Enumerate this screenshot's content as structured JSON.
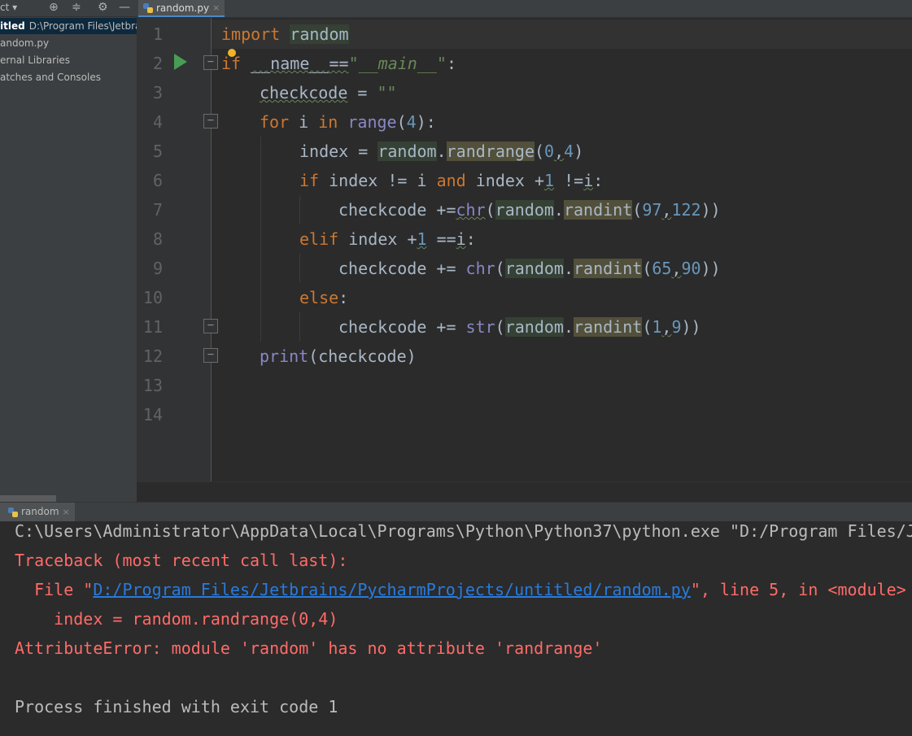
{
  "project_panel": {
    "title": "ct",
    "tree": [
      {
        "bold": "itled",
        "path": "D:\\Program Files\\Jetbra"
      },
      {
        "label": "andom.py"
      },
      {
        "label": "ernal Libraries"
      },
      {
        "label": "atches and Consoles"
      }
    ]
  },
  "editor_tab": {
    "label": "random.py",
    "close": "×"
  },
  "line_numbers": [
    "1",
    "2",
    "3",
    "4",
    "5",
    "6",
    "7",
    "8",
    "9",
    "10",
    "11",
    "12",
    "13",
    "14"
  ],
  "code": {
    "l1": [
      "import",
      "random"
    ],
    "l2": [
      "if",
      "__name__",
      "==",
      "\"__main__\"",
      ":"
    ],
    "l3": [
      "checkcode",
      " = ",
      "\"\""
    ],
    "l4": [
      "for",
      " i ",
      "in",
      " ",
      "range",
      "(",
      "4",
      "):"
    ],
    "l5": [
      "index = ",
      "random",
      ".",
      "randrange",
      "(",
      "0",
      ",",
      "4",
      ")"
    ],
    "l6": [
      "if",
      " index != i ",
      "and",
      " index +",
      "1",
      " !=",
      "i",
      ":"
    ],
    "l7": [
      "checkcode +=",
      "chr",
      "(",
      "random",
      ".",
      "randint",
      "(",
      "97",
      ",",
      "122",
      "))"
    ],
    "l8": [
      "elif",
      " index +",
      "1",
      " ==",
      "i",
      ":"
    ],
    "l9": [
      "checkcode += ",
      "chr",
      "(",
      "random",
      ".",
      "randint",
      "(",
      "65",
      ",",
      "90",
      "))"
    ],
    "l10": [
      "else",
      ":"
    ],
    "l11": [
      "checkcode += ",
      "str",
      "(",
      "random",
      ".",
      "randint",
      "(",
      "1",
      ",",
      "9",
      "))"
    ],
    "l12": [
      "print",
      "(checkcode)"
    ]
  },
  "run_tab": {
    "label": "random",
    "close": "×"
  },
  "console": {
    "cmd": "C:\\Users\\Administrator\\AppData\\Local\\Programs\\Python\\Python37\\python.exe \"D:/Program Files/J",
    "traceback": "Traceback (most recent call last):",
    "file_prefix": "  File \"",
    "file_link": "D:/Program Files/Jetbrains/PycharmProjects/untitled/random.py",
    "file_suffix": "\", line 5, in <module>",
    "code_line": "    index = random.randrange(0,4)",
    "error": "AttributeError: module 'random' has no attribute 'randrange'",
    "exit": "Process finished with exit code 1"
  },
  "colors": {
    "keyword": "#cc7832",
    "string": "#6a8759",
    "number": "#6897bb",
    "builtin": "#8888c6",
    "error": "#ff6b68",
    "link": "#287bde"
  }
}
